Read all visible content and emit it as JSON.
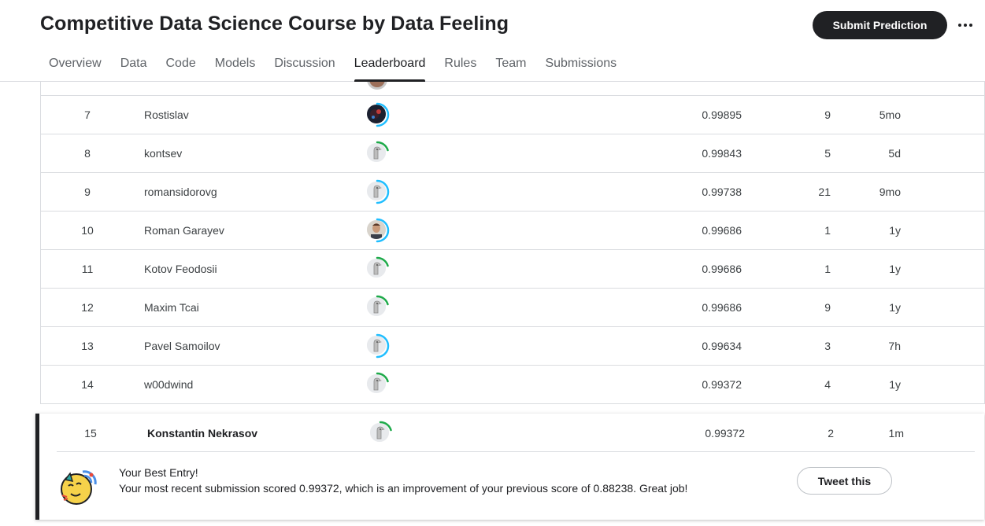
{
  "header": {
    "title": "Competitive Data Science Course by Data Feeling",
    "submit_label": "Submit Prediction",
    "more_label": "More options"
  },
  "tabs": [
    {
      "label": "Overview",
      "active": false
    },
    {
      "label": "Data",
      "active": false
    },
    {
      "label": "Code",
      "active": false
    },
    {
      "label": "Models",
      "active": false
    },
    {
      "label": "Discussion",
      "active": false
    },
    {
      "label": "Leaderboard",
      "active": true
    },
    {
      "label": "Rules",
      "active": false
    },
    {
      "label": "Team",
      "active": false
    },
    {
      "label": "Submissions",
      "active": false
    }
  ],
  "leaderboard": {
    "rows": [
      {
        "rank": "7",
        "name": "Rostislav",
        "avatar": "photo-dark",
        "ring": "blue",
        "score": "0.99895",
        "entries": "9",
        "last": "5mo"
      },
      {
        "rank": "8",
        "name": "kontsev",
        "avatar": "default",
        "ring": "green",
        "score": "0.99843",
        "entries": "5",
        "last": "5d"
      },
      {
        "rank": "9",
        "name": "romansidorovg",
        "avatar": "default",
        "ring": "blue",
        "score": "0.99738",
        "entries": "21",
        "last": "9mo"
      },
      {
        "rank": "10",
        "name": "Roman Garayev",
        "avatar": "photo-face",
        "ring": "blue",
        "score": "0.99686",
        "entries": "1",
        "last": "1y"
      },
      {
        "rank": "11",
        "name": "Kotov Feodosii",
        "avatar": "default",
        "ring": "green",
        "score": "0.99686",
        "entries": "1",
        "last": "1y"
      },
      {
        "rank": "12",
        "name": "Maxim Tcai",
        "avatar": "default",
        "ring": "green",
        "score": "0.99686",
        "entries": "9",
        "last": "1y"
      },
      {
        "rank": "13",
        "name": "Pavel Samoilov",
        "avatar": "default",
        "ring": "blue",
        "score": "0.99634",
        "entries": "3",
        "last": "7h"
      },
      {
        "rank": "14",
        "name": "w00dwind",
        "avatar": "default",
        "ring": "green",
        "score": "0.99372",
        "entries": "4",
        "last": "1y"
      }
    ],
    "my_entry": {
      "rank": "15",
      "name": "Konstantin Nekrasov",
      "avatar": "default",
      "ring": "green",
      "score": "0.99372",
      "entries": "2",
      "last": "1m"
    }
  },
  "best_entry": {
    "title": "Your Best Entry!",
    "message": "Your most recent submission scored 0.99372, which is an improvement of your previous score of 0.88238. Great job!",
    "tweet_label": "Tweet this",
    "icon": "party-face-icon"
  },
  "colors": {
    "ring_blue": "#20beff",
    "ring_green": "#1eaa4a",
    "dark": "#202124",
    "divider": "#dadce0"
  }
}
